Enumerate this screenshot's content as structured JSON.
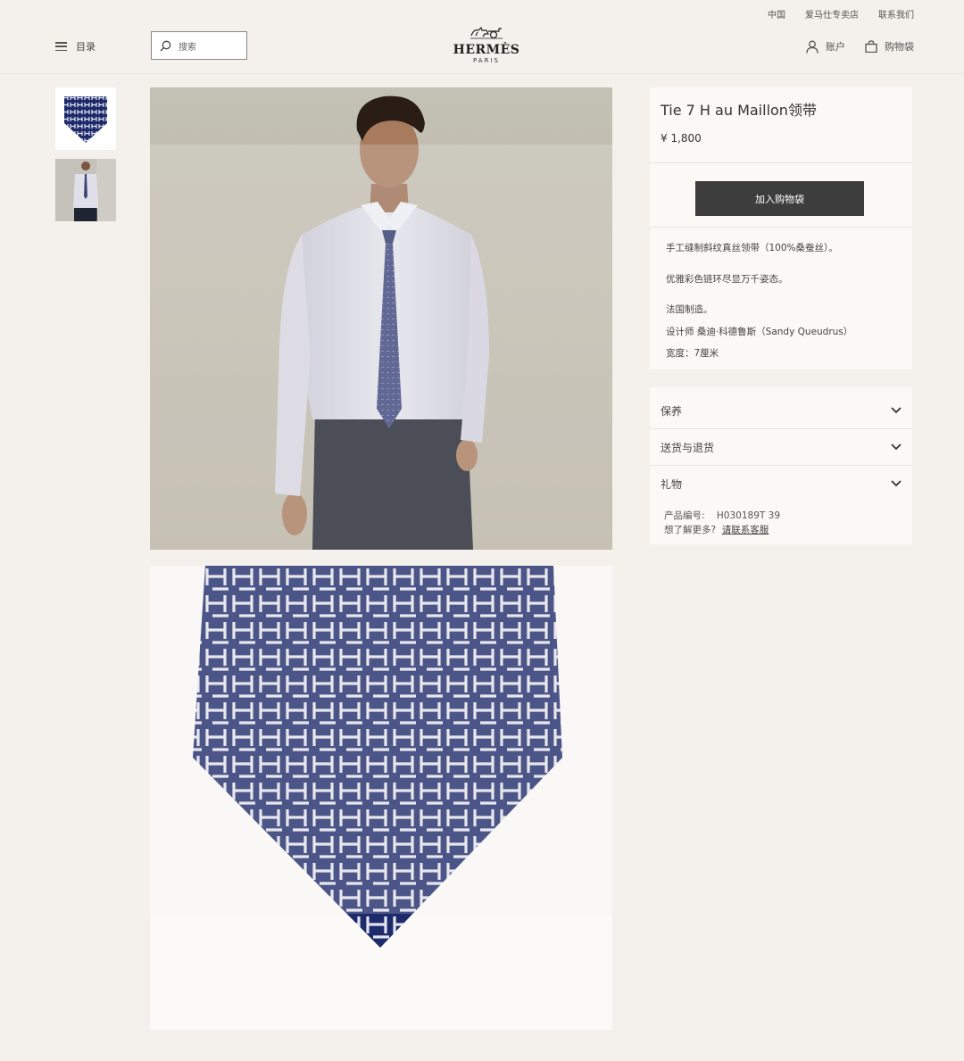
{
  "topbar": {
    "region": "中国",
    "stores": "爱马仕专卖店",
    "contact": "联系我们"
  },
  "header": {
    "menu_label": "目录",
    "search_placeholder": "搜索",
    "brand": "HERMÈS",
    "brand_city": "PARIS",
    "account_label": "账户",
    "cart_label": "购物袋"
  },
  "product": {
    "title": "Tie 7 H au Maillon领带",
    "price": "¥ 1,800",
    "add_to_cart": "加入购物袋",
    "description": [
      "手工缝制斜纹真丝领带（100%桑蚕丝）。",
      "优雅彩色链环尽显万千姿态。",
      "法国制造。",
      "设计师 桑迪·科德鲁斯（Sandy Queudrus）",
      "宽度：7厘米"
    ]
  },
  "accordion": [
    {
      "label": "保养"
    },
    {
      "label": "送货与退货"
    },
    {
      "label": "礼物"
    }
  ],
  "meta": {
    "sku_label": "产品编号:",
    "sku_value": "H030189T 39",
    "more_label": "想了解更多?",
    "contact_link": "请联系客服"
  },
  "colors": {
    "button": "#3d3d3d",
    "tie_navy": "#1d2a6b",
    "background": "#f4f0eb"
  },
  "icons": [
    "menu-icon",
    "search-icon",
    "horse-carriage-logo",
    "user-icon",
    "bag-icon",
    "chevron-down-icon"
  ]
}
